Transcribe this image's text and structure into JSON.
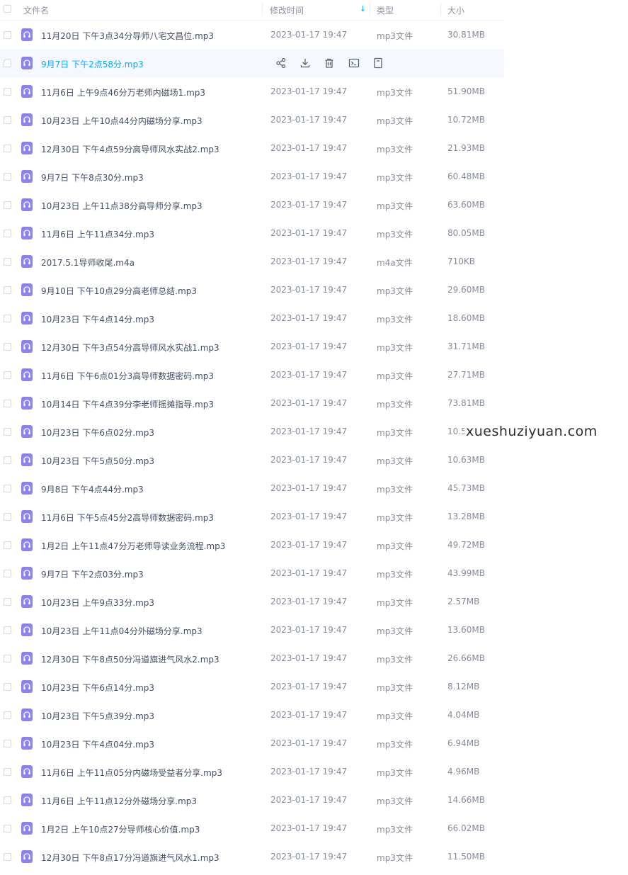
{
  "header": {
    "name_label": "文件名",
    "mtime_label": "修改时间",
    "sort_indicator": "↓",
    "type_label": "类型",
    "size_label": "大小"
  },
  "hover_actions": [
    "share-icon",
    "download-icon",
    "delete-icon",
    "rename-icon",
    "more-icon"
  ],
  "colors": {
    "accent": "#06a7ff",
    "file_icon": "#8b84f0",
    "active_row_bg": "#f5f9ff"
  },
  "files": [
    {
      "name": "11月20日 下午3点34分导师八宅文昌位.mp3",
      "mtime": "2023-01-17 19:47",
      "type": "mp3文件",
      "size": "30.81MB"
    },
    {
      "name": "9月7日 下午2点58分.mp3",
      "mtime": "",
      "type": "",
      "size": "",
      "active": true
    },
    {
      "name": "11月6日 上午9点46分万老师内磁场1.mp3",
      "mtime": "2023-01-17 19:47",
      "type": "mp3文件",
      "size": "51.90MB"
    },
    {
      "name": "10月23日 上午10点44分内磁场分享.mp3",
      "mtime": "2023-01-17 19:47",
      "type": "mp3文件",
      "size": "10.72MB"
    },
    {
      "name": "12月30日 下午4点59分高导师风水实战2.mp3",
      "mtime": "2023-01-17 19:47",
      "type": "mp3文件",
      "size": "21.93MB"
    },
    {
      "name": "9月7日 下午8点30分.mp3",
      "mtime": "2023-01-17 19:47",
      "type": "mp3文件",
      "size": "60.48MB"
    },
    {
      "name": "10月23日 上午11点38分高导师分享.mp3",
      "mtime": "2023-01-17 19:47",
      "type": "mp3文件",
      "size": "63.60MB"
    },
    {
      "name": "11月6日 上午11点34分.mp3",
      "mtime": "2023-01-17 19:47",
      "type": "mp3文件",
      "size": "80.05MB"
    },
    {
      "name": "2017.5.1导师收尾.m4a",
      "mtime": "2023-01-17 19:47",
      "type": "m4a文件",
      "size": "710KB"
    },
    {
      "name": "9月10日 下午10点29分高老师总结.mp3",
      "mtime": "2023-01-17 19:47",
      "type": "mp3文件",
      "size": "29.60MB"
    },
    {
      "name": "10月23日 下午4点14分.mp3",
      "mtime": "2023-01-17 19:47",
      "type": "mp3文件",
      "size": "18.60MB"
    },
    {
      "name": "12月30日 下午3点54分高导师风水实战1.mp3",
      "mtime": "2023-01-17 19:47",
      "type": "mp3文件",
      "size": "31.71MB"
    },
    {
      "name": "11月6日 下午6点01分3高导师数据密码.mp3",
      "mtime": "2023-01-17 19:47",
      "type": "mp3文件",
      "size": "27.71MB"
    },
    {
      "name": "10月14日 下午4点39分李老师摇摊指导.mp3",
      "mtime": "2023-01-17 19:47",
      "type": "mp3文件",
      "size": "73.81MB"
    },
    {
      "name": "10月23日 下午6点02分.mp3",
      "mtime": "2023-01-17 19:47",
      "type": "mp3文件",
      "size": "10.5"
    },
    {
      "name": "10月23日 下午5点50分.mp3",
      "mtime": "2023-01-17 19:47",
      "type": "mp3文件",
      "size": "10.63MB"
    },
    {
      "name": "9月8日 下午4点44分.mp3",
      "mtime": "2023-01-17 19:47",
      "type": "mp3文件",
      "size": "45.73MB"
    },
    {
      "name": "11月6日 下午5点45分2高导师数据密码.mp3",
      "mtime": "2023-01-17 19:47",
      "type": "mp3文件",
      "size": "13.28MB"
    },
    {
      "name": "1月2日 上午11点47分万老师导读业务流程.mp3",
      "mtime": "2023-01-17 19:47",
      "type": "mp3文件",
      "size": "49.72MB"
    },
    {
      "name": "9月7日 下午2点03分.mp3",
      "mtime": "2023-01-17 19:47",
      "type": "mp3文件",
      "size": "43.99MB"
    },
    {
      "name": "10月23日 上午9点33分.mp3",
      "mtime": "2023-01-17 19:47",
      "type": "mp3文件",
      "size": "2.57MB"
    },
    {
      "name": "10月23日 上午11点04分外磁场分享.mp3",
      "mtime": "2023-01-17 19:47",
      "type": "mp3文件",
      "size": "13.60MB"
    },
    {
      "name": "12月30日 下午8点50分冯道旗进气风水2.mp3",
      "mtime": "2023-01-17 19:47",
      "type": "mp3文件",
      "size": "26.66MB"
    },
    {
      "name": "10月23日 下午6点14分.mp3",
      "mtime": "2023-01-17 19:47",
      "type": "mp3文件",
      "size": "8.12MB"
    },
    {
      "name": "10月23日 下午5点39分.mp3",
      "mtime": "2023-01-17 19:47",
      "type": "mp3文件",
      "size": "4.04MB"
    },
    {
      "name": "10月23日 下午4点04分.mp3",
      "mtime": "2023-01-17 19:47",
      "type": "mp3文件",
      "size": "6.94MB"
    },
    {
      "name": "11月6日 上午11点05分内磁场受益者分享.mp3",
      "mtime": "2023-01-17 19:47",
      "type": "mp3文件",
      "size": "4.96MB"
    },
    {
      "name": "11月6日 上午11点12分外磁场分享.mp3",
      "mtime": "2023-01-17 19:47",
      "type": "mp3文件",
      "size": "14.66MB"
    },
    {
      "name": "1月2日 上午10点27分导师核心价值.mp3",
      "mtime": "2023-01-17 19:47",
      "type": "mp3文件",
      "size": "66.02MB"
    },
    {
      "name": "12月30日 下午8点17分冯道旗进气风水1.mp3",
      "mtime": "2023-01-17 19:47",
      "type": "mp3文件",
      "size": "11.50MB"
    }
  ],
  "watermark": "xueshuziyuan.com"
}
